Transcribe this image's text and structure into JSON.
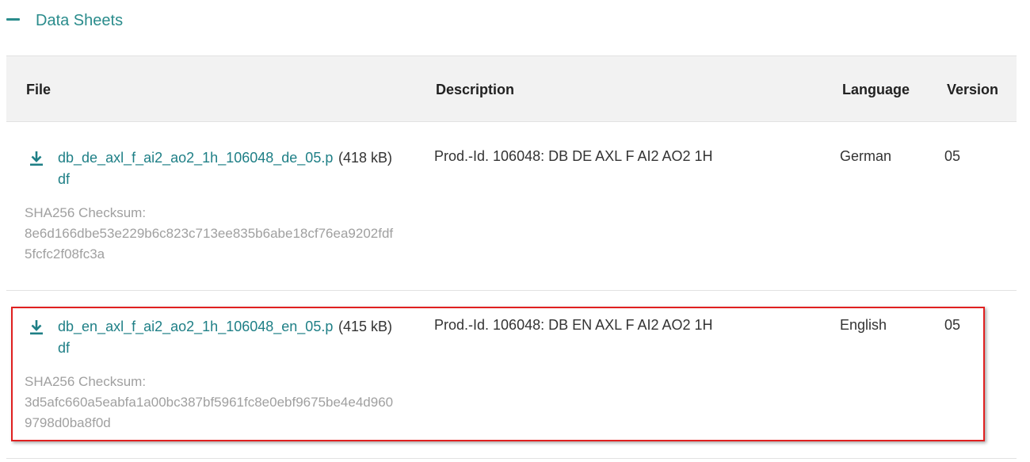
{
  "section": {
    "title": "Data Sheets"
  },
  "table": {
    "headers": {
      "file": "File",
      "description": "Description",
      "language": "Language",
      "version": "Version"
    },
    "rows": [
      {
        "file_name": "db_de_axl_f_ai2_ao2_1h_106048_de_05.pdf",
        "file_size": "(418 kB)",
        "checksum_label": "SHA256 Checksum:",
        "checksum": "8e6d166dbe53e229b6c823c713ee835b6abe18cf76ea9202fdf5fcfc2f08fc3a",
        "description": "Prod.-Id. 106048: DB DE AXL F AI2 AO2 1H",
        "language": "German",
        "version": "05"
      },
      {
        "file_name": "db_en_axl_f_ai2_ao2_1h_106048_en_05.pdf",
        "file_size": "(415 kB)",
        "checksum_label": "SHA256 Checksum:",
        "checksum": "3d5afc660a5eabfa1a00bc387bf5961fc8e0ebf9675be4e4d9609798d0ba8f0d",
        "description": "Prod.-Id. 106048: DB EN AXL F AI2 AO2 1H",
        "language": "English",
        "version": "05"
      }
    ]
  },
  "colors": {
    "accent": "#2a8c8c",
    "link": "#1e7f86",
    "highlight_border": "#e02020",
    "header_bg": "#f2f2f2",
    "muted_text": "#a0a0a0"
  }
}
